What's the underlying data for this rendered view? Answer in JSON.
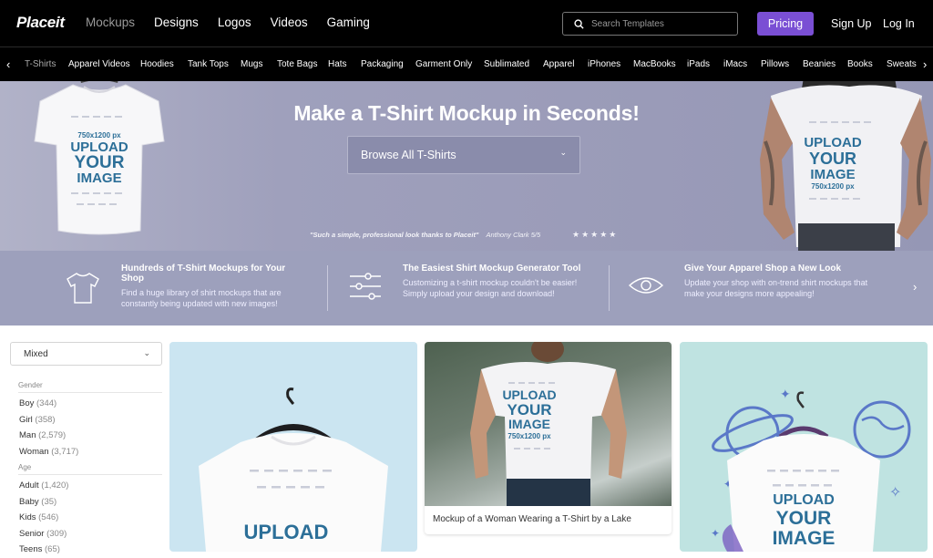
{
  "header": {
    "logo": "Placeit",
    "nav": [
      "Mockups",
      "Designs",
      "Logos",
      "Videos",
      "Gaming"
    ],
    "search_placeholder": "Search Templates",
    "pricing": "Pricing",
    "signup": "Sign Up",
    "login": "Log In"
  },
  "categories": [
    "T-Shirts",
    "Apparel Videos",
    "Hoodies",
    "Tank Tops",
    "Mugs",
    "Tote Bags",
    "Hats",
    "Packaging",
    "Garment Only",
    "Sublimated",
    "Apparel",
    "iPhones",
    "MacBooks",
    "iPads",
    "iMacs",
    "Pillows",
    "Beanies",
    "Books",
    "Sweats"
  ],
  "hero": {
    "title": "Make a T-Shirt Mockup in Seconds!",
    "browse": "Browse All T-Shirts",
    "quote": "\"Such a simple, professional look thanks to Placeit\"",
    "author": "Anthony Clark 5/5",
    "stars": "★★★★★",
    "left_shirt": {
      "size": "750x1200 px",
      "upload": "UPLOAD",
      "your": "YOUR",
      "image": "IMAGE"
    },
    "right_shirt": {
      "upload": "UPLOAD",
      "your": "YOUR",
      "image": "IMAGE",
      "size": "750x1200 px"
    }
  },
  "features": [
    {
      "title": "Hundreds of T-Shirt Mockups for Your Shop",
      "text": "Find a huge library of shirt mockups that are constantly being updated with new images!"
    },
    {
      "title": "The Easiest Shirt Mockup Generator Tool",
      "text": "Customizing a t-shirt mockup couldn't be easier! Simply upload your design and download!"
    },
    {
      "title": "Give Your Apparel Shop a New Look",
      "text": "Update your shop with on-trend shirt mockups that make your designs more appealing!"
    }
  ],
  "sidebar": {
    "sort": "Mixed",
    "gender_label": "Gender",
    "gender": [
      {
        "name": "Boy",
        "count": "(344)"
      },
      {
        "name": "Girl",
        "count": "(358)"
      },
      {
        "name": "Man",
        "count": "(2,579)"
      },
      {
        "name": "Woman",
        "count": "(3,717)"
      }
    ],
    "age_label": "Age",
    "age": [
      {
        "name": "Adult",
        "count": "(1,420)"
      },
      {
        "name": "Baby",
        "count": "(35)"
      },
      {
        "name": "Kids",
        "count": "(546)"
      },
      {
        "name": "Senior",
        "count": "(309)"
      },
      {
        "name": "Teens",
        "count": "(65)"
      }
    ]
  },
  "cards": {
    "card1": {
      "upload": "UPLOAD"
    },
    "card2": {
      "caption": "Mockup of a Woman Wearing a T-Shirt by a Lake",
      "upload": "UPLOAD",
      "your": "YOUR",
      "image": "IMAGE",
      "size": "750x1200 px"
    },
    "card3": {
      "upload": "UPLOAD",
      "your": "YOUR",
      "image": "IMAGE"
    }
  }
}
